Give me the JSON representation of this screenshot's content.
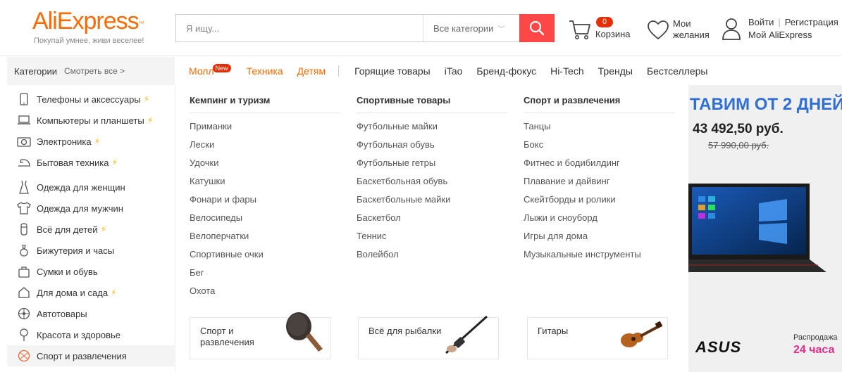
{
  "header": {
    "logo_text": "AliExpress",
    "logo_tm": "™",
    "tagline": "Покупай умнее, живи веселее!",
    "search_placeholder": "Я ищу...",
    "search_category": "Все категории",
    "cart_count": "0",
    "cart_label": "Корзина",
    "wishlist_label": "Мои желания",
    "login_label": "Войти",
    "register_label": "Регистрация",
    "my_aliexpress_label": "Мой AliExpress"
  },
  "categories_header": {
    "title": "Категории",
    "see_all": "Смотреть все >"
  },
  "nav": {
    "items": [
      {
        "label": "Молл",
        "badge": "New"
      },
      {
        "label": "Техника"
      },
      {
        "label": "Детям"
      },
      {
        "label": "Горящие товары"
      },
      {
        "label": "iTao"
      },
      {
        "label": "Бренд-фокус"
      },
      {
        "label": "Hi-Tech"
      },
      {
        "label": "Тренды"
      },
      {
        "label": "Бестселлеры"
      }
    ]
  },
  "sidebar": {
    "items": [
      {
        "label": "Телефоны и аксессуары",
        "icon": "phone-icon",
        "flash": true
      },
      {
        "label": "Компьютеры и планшеты",
        "icon": "laptop-icon",
        "flash": true
      },
      {
        "label": "Электроника",
        "icon": "camera-icon",
        "flash": true
      },
      {
        "label": "Бытовая техника",
        "icon": "iron-icon",
        "flash": true
      },
      {
        "label": "Одежда для женщин",
        "icon": "dress-icon",
        "flash": false
      },
      {
        "label": "Одежда для мужчин",
        "icon": "shirt-icon",
        "flash": false
      },
      {
        "label": "Всё для детей",
        "icon": "baby-icon",
        "flash": true
      },
      {
        "label": "Бижутерия и часы",
        "icon": "ring-icon",
        "flash": false
      },
      {
        "label": "Сумки и обувь",
        "icon": "bag-icon",
        "flash": false
      },
      {
        "label": "Для дома и сада",
        "icon": "home-icon",
        "flash": true
      },
      {
        "label": "Автотовары",
        "icon": "wheel-icon",
        "flash": false
      },
      {
        "label": "Красота и здоровье",
        "icon": "lipstick-icon",
        "flash": false
      },
      {
        "label": "Спорт и развлечения",
        "icon": "basketball-icon",
        "flash": false,
        "active": true
      }
    ]
  },
  "dropdown": {
    "columns": [
      {
        "title": "Кемпинг и туризм",
        "items": [
          "Приманки",
          "Лески",
          "Удочки",
          "Катушки",
          "Фонари и фары",
          "Велосипеды",
          "Велоперчатки",
          "Спортивные очки",
          "Бег",
          "Охота"
        ]
      },
      {
        "title": "Спортивные товары",
        "items": [
          "Футбольные майки",
          "Футбольная обувь",
          "Футбольные гетры",
          "Баскетбольная обувь",
          "Баскетбольные майки",
          "Баскетбол",
          "Теннис",
          "Волейбол"
        ]
      },
      {
        "title": "Спорт и развлечения",
        "items": [
          "Танцы",
          "Бокс",
          "Фитнес и бодибилдинг",
          "Плавание и дайвинг",
          "Скейтборды и ролики",
          "Лыжи и сноуборд",
          "Игры для дома",
          "Музыкальные инструменты"
        ]
      }
    ],
    "promos": [
      {
        "label": "Спорт и развлечения",
        "icon": "ping-pong-paddle-icon"
      },
      {
        "label": "Всё для рыбалки",
        "icon": "fishing-rod-icon"
      },
      {
        "label": "Гитары",
        "icon": "ukulele-icon"
      }
    ]
  },
  "banner": {
    "headline": "ТАВИМ ОТ 2 ДНЕЙ",
    "price": "43 492,50 руб.",
    "old_price": "57 990,00 руб.",
    "brand": "ASUS",
    "sale_label": "Распродажа",
    "sale_time": "24 часа",
    "colors": {
      "headline": "#2f6fd6",
      "sale_time": "#e62e8a"
    }
  },
  "colors": {
    "accent": "#ff6a00",
    "search_button": "#ff4747",
    "badge": "#e62e04"
  }
}
